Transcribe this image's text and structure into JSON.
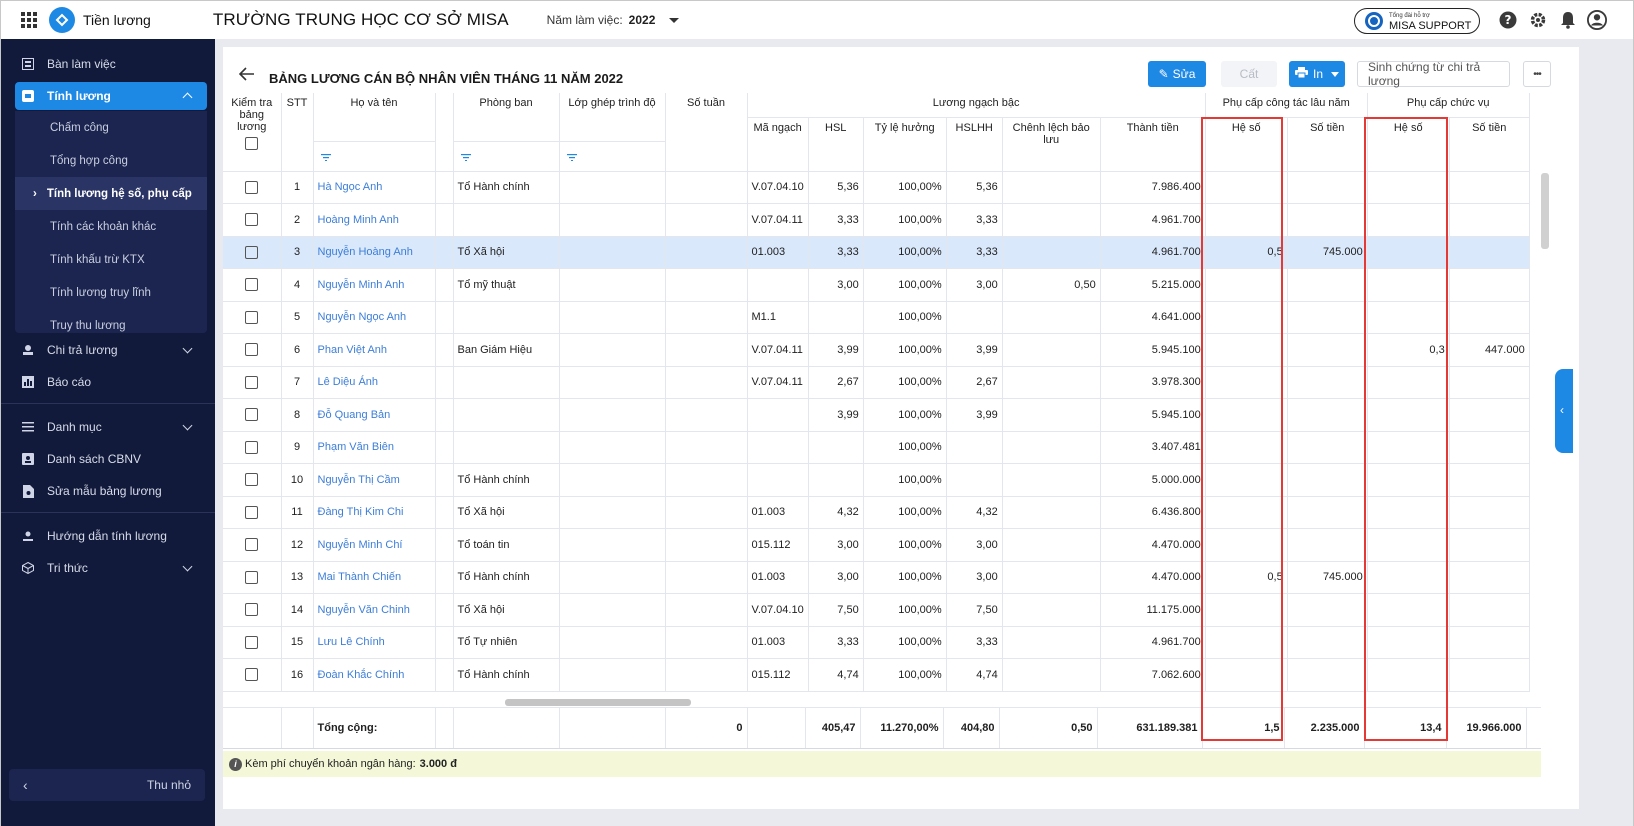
{
  "topbar": {
    "app_name": "Tiền lương",
    "school": "TRƯỜNG TRUNG HỌC CƠ SỞ MISA",
    "year_label": "Năm làm việc:",
    "year_value": "2022",
    "support_small": "Tổng đài hỗ trợ",
    "support_big": "MISA SUPPORT"
  },
  "sidebar": {
    "items": [
      {
        "label": "Bàn làm việc",
        "icon": "dashboard-icon"
      },
      {
        "label": "Tính lương",
        "icon": "payroll-icon"
      },
      {
        "label": "Chi trả lương",
        "icon": "payment-icon"
      },
      {
        "label": "Báo cáo",
        "icon": "report-icon"
      },
      {
        "label": "Danh mục",
        "icon": "list-icon"
      },
      {
        "label": "Danh sách CBNV",
        "icon": "staff-icon"
      },
      {
        "label": "Sửa mẫu bảng lương",
        "icon": "template-icon"
      },
      {
        "label": "Hướng dẫn tính lương",
        "icon": "guide-icon"
      },
      {
        "label": "Tri thức",
        "icon": "knowledge-icon"
      }
    ],
    "sub": [
      "Chấm công",
      "Tổng hợp công",
      "Tính lương hệ số, phụ cấp",
      "Tính các khoản khác",
      "Tính khấu trừ KTX",
      "Tính lương truy lĩnh",
      "Truy thu lương"
    ],
    "collapse": "Thu nhỏ"
  },
  "page": {
    "title": "BẢNG LƯƠNG CÁN BỘ NHÂN VIÊN THÁNG 11 NĂM 2022",
    "edit": "Sửa",
    "save": "Cất",
    "print": "In",
    "voucher": "Sinh chứng từ chi trả lương",
    "more": "•••"
  },
  "headers": {
    "check": "Kiểm tra bảng lương",
    "stt": "STT",
    "name": "Họ và tên",
    "dept": "Phòng ban",
    "class": "Lớp ghép trình độ",
    "weeks": "Số tuần",
    "grade_group": "Lương ngạch bậc",
    "code": "Mã ngạch",
    "hsl": "HSL",
    "rate": "Tỷ lệ hưởng",
    "hslhh": "HSLHH",
    "diff": "Chênh lệch bảo lưu",
    "amount": "Thành tiền",
    "senior_group": "Phụ cấp công tác lâu năm",
    "coef": "Hệ số",
    "money": "Số tiền",
    "position_group": "Phụ cấp chức vụ"
  },
  "rows": [
    {
      "stt": "1",
      "name": "Hà Ngọc Anh",
      "dept": "Tổ Hành chính",
      "code": "V.07.04.10",
      "hsl": "5,36",
      "rate": "100,00%",
      "hslhh": "5,36",
      "diff": "",
      "amount": "7.986.400",
      "sc": "",
      "sm": "",
      "pc": "",
      "pm": ""
    },
    {
      "stt": "2",
      "name": "Hoàng Minh Anh",
      "dept": "",
      "code": "V.07.04.11",
      "hsl": "3,33",
      "rate": "100,00%",
      "hslhh": "3,33",
      "diff": "",
      "amount": "4.961.700",
      "sc": "",
      "sm": "",
      "pc": "",
      "pm": ""
    },
    {
      "stt": "3",
      "name": "Nguyễn Hoàng Anh",
      "dept": "Tổ Xã hội",
      "code": "01.003",
      "hsl": "3,33",
      "rate": "100,00%",
      "hslhh": "3,33",
      "diff": "",
      "amount": "4.961.700",
      "sc": "0,5",
      "sm": "745.000",
      "pc": "",
      "pm": ""
    },
    {
      "stt": "4",
      "name": "Nguyễn Minh Anh",
      "dept": "Tổ mỹ thuật",
      "code": "",
      "hsl": "3,00",
      "rate": "100,00%",
      "hslhh": "3,00",
      "diff": "0,50",
      "amount": "5.215.000",
      "sc": "",
      "sm": "",
      "pc": "",
      "pm": ""
    },
    {
      "stt": "5",
      "name": "Nguyễn Ngọc Anh",
      "dept": "",
      "code": "M1.1",
      "hsl": "",
      "rate": "100,00%",
      "hslhh": "",
      "diff": "",
      "amount": "4.641.000",
      "sc": "",
      "sm": "",
      "pc": "",
      "pm": ""
    },
    {
      "stt": "6",
      "name": "Phan Việt Anh",
      "dept": "Ban Giám Hiệu",
      "code": "V.07.04.11",
      "hsl": "3,99",
      "rate": "100,00%",
      "hslhh": "3,99",
      "diff": "",
      "amount": "5.945.100",
      "sc": "",
      "sm": "",
      "pc": "0,3",
      "pm": "447.000"
    },
    {
      "stt": "7",
      "name": "Lê Diệu Ánh",
      "dept": "",
      "code": "V.07.04.11",
      "hsl": "2,67",
      "rate": "100,00%",
      "hslhh": "2,67",
      "diff": "",
      "amount": "3.978.300",
      "sc": "",
      "sm": "",
      "pc": "",
      "pm": ""
    },
    {
      "stt": "8",
      "name": "Đỗ Quang Bản",
      "dept": "",
      "code": "",
      "hsl": "3,99",
      "rate": "100,00%",
      "hslhh": "3,99",
      "diff": "",
      "amount": "5.945.100",
      "sc": "",
      "sm": "",
      "pc": "",
      "pm": ""
    },
    {
      "stt": "9",
      "name": "Phạm Văn Biên",
      "dept": "",
      "code": "",
      "hsl": "",
      "rate": "100,00%",
      "hslhh": "",
      "diff": "",
      "amount": "3.407.481",
      "sc": "",
      "sm": "",
      "pc": "",
      "pm": ""
    },
    {
      "stt": "10",
      "name": "Nguyễn Thị Cầm",
      "dept": "Tổ Hành chính",
      "code": "",
      "hsl": "",
      "rate": "100,00%",
      "hslhh": "",
      "diff": "",
      "amount": "5.000.000",
      "sc": "",
      "sm": "",
      "pc": "",
      "pm": ""
    },
    {
      "stt": "11",
      "name": "Đàng Thị Kim Chi",
      "dept": "Tổ Xã hội",
      "code": "01.003",
      "hsl": "4,32",
      "rate": "100,00%",
      "hslhh": "4,32",
      "diff": "",
      "amount": "6.436.800",
      "sc": "",
      "sm": "",
      "pc": "",
      "pm": ""
    },
    {
      "stt": "12",
      "name": "Nguyễn Minh Chí",
      "dept": "Tổ toán tin",
      "code": "015.112",
      "hsl": "3,00",
      "rate": "100,00%",
      "hslhh": "3,00",
      "diff": "",
      "amount": "4.470.000",
      "sc": "",
      "sm": "",
      "pc": "",
      "pm": ""
    },
    {
      "stt": "13",
      "name": "Mai Thành Chiến",
      "dept": "Tổ Hành chính",
      "code": "01.003",
      "hsl": "3,00",
      "rate": "100,00%",
      "hslhh": "3,00",
      "diff": "",
      "amount": "4.470.000",
      "sc": "0,5",
      "sm": "745.000",
      "pc": "",
      "pm": ""
    },
    {
      "stt": "14",
      "name": "Nguyễn Văn Chinh",
      "dept": "Tổ Xã hội",
      "code": "V.07.04.10",
      "hsl": "7,50",
      "rate": "100,00%",
      "hslhh": "7,50",
      "diff": "",
      "amount": "11.175.000",
      "sc": "",
      "sm": "",
      "pc": "",
      "pm": ""
    },
    {
      "stt": "15",
      "name": "Lưu Lê Chính",
      "dept": "Tổ Tự nhiên",
      "code": "01.003",
      "hsl": "3,33",
      "rate": "100,00%",
      "hslhh": "3,33",
      "diff": "",
      "amount": "4.961.700",
      "sc": "",
      "sm": "",
      "pc": "",
      "pm": ""
    },
    {
      "stt": "16",
      "name": "Đoàn Khắc Chính",
      "dept": "Tổ Hành chính",
      "code": "015.112",
      "hsl": "4,74",
      "rate": "100,00%",
      "hslhh": "4,74",
      "diff": "",
      "amount": "7.062.600",
      "sc": "",
      "sm": "",
      "pc": "",
      "pm": ""
    }
  ],
  "totals": {
    "label": "Tổng cộng:",
    "weeks": "0",
    "hsl": "405,47",
    "rate": "11.270,00%",
    "hslhh": "404,80",
    "diff": "0,50",
    "amount": "631.189.381",
    "sc": "1,5",
    "sm": "2.235.000",
    "pc": "13,4",
    "pm": "19.966.000"
  },
  "note": {
    "text": "Kèm phí chuyển khoản ngân hàng:",
    "value": "3.000 đ"
  }
}
